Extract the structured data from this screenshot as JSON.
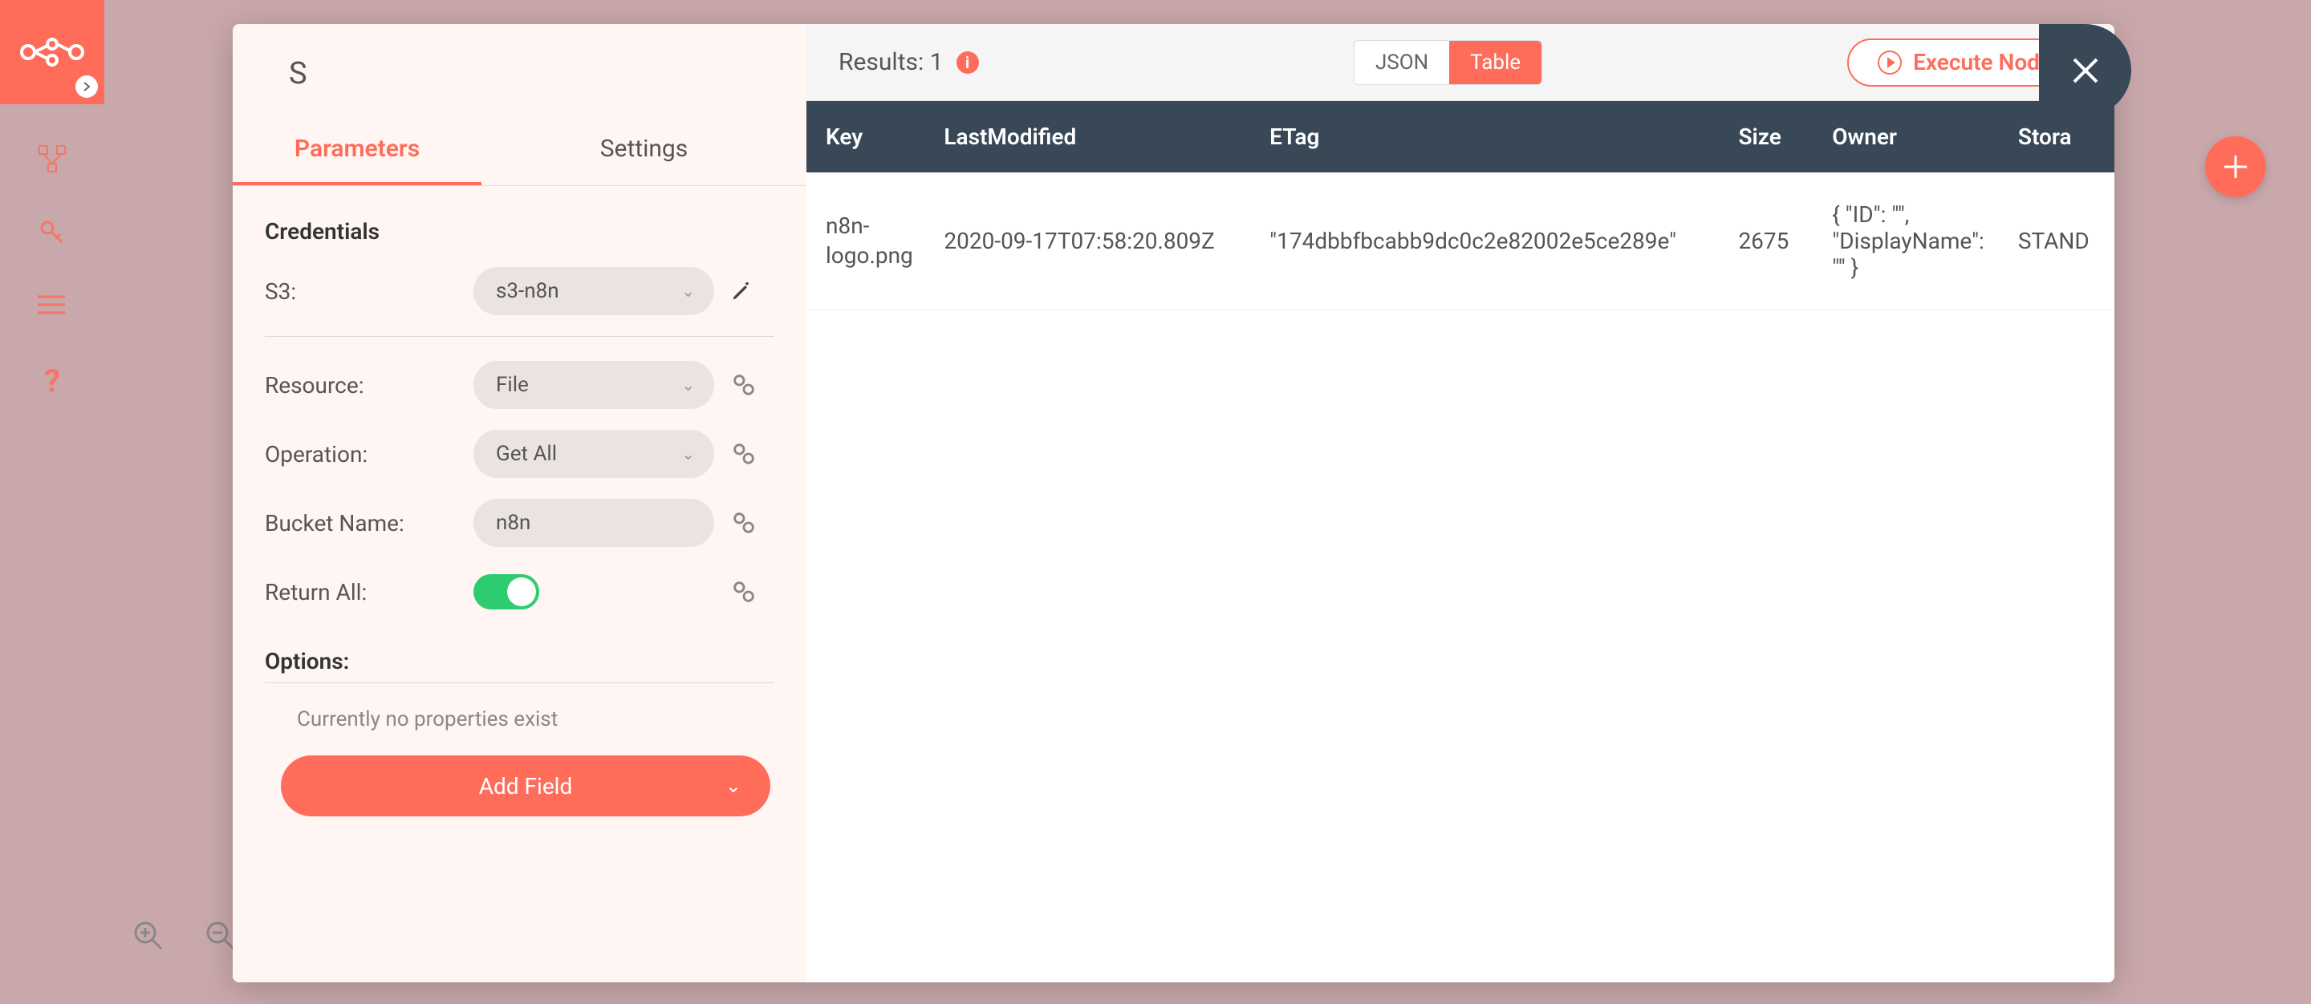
{
  "node": {
    "title": "S"
  },
  "tabs": {
    "parameters": "Parameters",
    "settings": "Settings"
  },
  "credentials": {
    "heading": "Credentials",
    "s3_label": "S3:",
    "s3_value": "s3-n8n"
  },
  "params": {
    "resource_label": "Resource:",
    "resource_value": "File",
    "operation_label": "Operation:",
    "operation_value": "Get All",
    "bucket_label": "Bucket Name:",
    "bucket_value": "n8n",
    "return_all_label": "Return All:",
    "return_all_value": true
  },
  "options": {
    "heading": "Options:",
    "empty_text": "Currently no properties exist",
    "add_field_label": "Add Field"
  },
  "results": {
    "label": "Results: 1",
    "view_json": "JSON",
    "view_table": "Table",
    "execute_label": "Execute Node"
  },
  "table": {
    "headers": [
      "Key",
      "LastModified",
      "ETag",
      "Size",
      "Owner",
      "Stora"
    ],
    "rows": [
      {
        "key": "n8n-logo.png",
        "last_modified": "2020-09-17T07:58:20.809Z",
        "etag": "\"174dbbfbcabb9dc0c2e82002e5ce289e\"",
        "size": "2675",
        "owner": "{ \"ID\": \"\", \"DisplayName\": \"\" }",
        "storage": "STAND"
      }
    ]
  }
}
